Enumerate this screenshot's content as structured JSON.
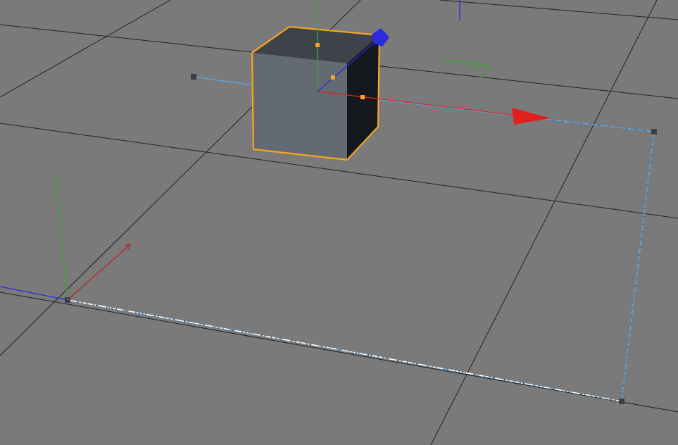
{
  "viewport": {
    "background": "#7a7a7a",
    "grid_color": "#222222"
  },
  "colors": {
    "x_axis": "#e02020",
    "y_axis": "#2faa2f",
    "z_axis": "#2a2ae0",
    "selection": "#f5a623",
    "spline": "#5aa8e8",
    "spline_highlight": "#ffffff",
    "point": "#3a3f46",
    "cube_front": "#646a72",
    "cube_top": "#3e4249",
    "cube_side": "#15181c"
  },
  "objects": {
    "cube": {
      "name": "Cube",
      "selected": true,
      "icon": "cube-icon"
    },
    "spline": {
      "name": "Spline",
      "closed": true,
      "point_count": 4,
      "icon": "spline-icon"
    },
    "world_axis": {
      "icon": "world-axis-icon"
    },
    "move_gizmo": {
      "icon": "move-gizmo-icon",
      "handles": [
        "X",
        "Y",
        "Z"
      ]
    }
  }
}
